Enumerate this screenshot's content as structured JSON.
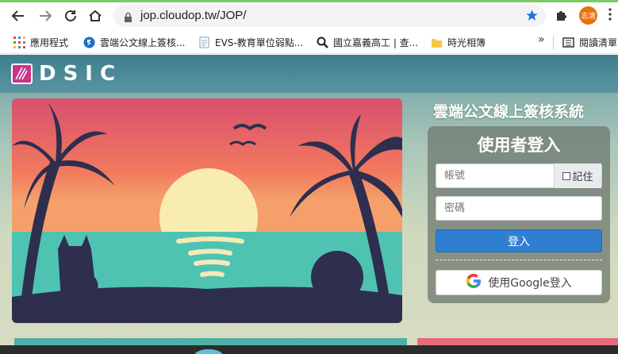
{
  "browser": {
    "url": "jop.cloudop.tw/JOP/",
    "profile_initials": "志鴻"
  },
  "bookmarks": [
    {
      "label": "應用程式",
      "icon": "apps-grid-icon"
    },
    {
      "label": "雲端公文線上簽核...",
      "icon": "cloud-doc-icon"
    },
    {
      "label": "EVS-教育單位弱點...",
      "icon": "page-icon"
    },
    {
      "label": "國立嘉義高工 | 查...",
      "icon": "search-site-icon"
    },
    {
      "label": "時光相簿",
      "icon": "folder-icon"
    }
  ],
  "reading_list": "閱讀清單",
  "site": {
    "logo_text": "DSIC",
    "system_title": "雲端公文線上簽核系統"
  },
  "login": {
    "title": "使用者登入",
    "account_placeholder": "帳號",
    "remember_label": "記住",
    "password_placeholder": "密碼",
    "login_button": "登入",
    "google_button": "使用Google登入"
  },
  "colors": {
    "accent_blue": "#2f7fd0",
    "header_teal": "#3f7e8e",
    "logo_magenta": "#c9348a"
  }
}
